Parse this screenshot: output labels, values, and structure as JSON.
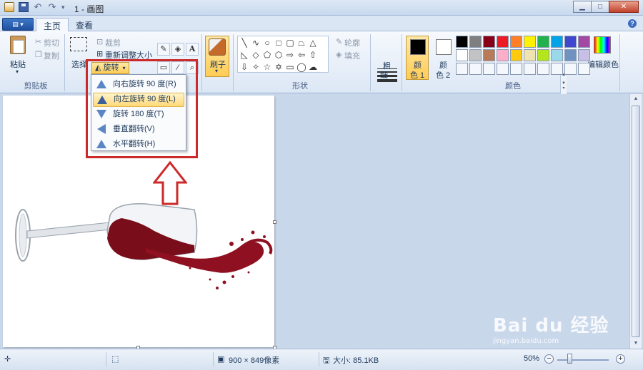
{
  "window": {
    "title": "1 - 画图"
  },
  "tabs": [
    {
      "label": "主页"
    },
    {
      "label": "查看"
    }
  ],
  "clipboard": {
    "paste": "粘贴",
    "cut": "剪切",
    "copy": "复制",
    "group": "剪贴板"
  },
  "image": {
    "select": "选择",
    "crop": "裁剪",
    "resize": "重新调整大小",
    "rotate": "旋转"
  },
  "rotate_menu": {
    "items": [
      {
        "label": "向右旋转 90 度(R)"
      },
      {
        "label": "向左旋转 90 度(L)"
      },
      {
        "label": "旋转 180 度(T)"
      },
      {
        "label": "垂直翻转(V)"
      },
      {
        "label": "水平翻转(H)"
      }
    ],
    "highlighted_index": 1
  },
  "brushes": {
    "label": "刷子"
  },
  "shapes": {
    "outline": "轮廓",
    "fill": "填充",
    "group": "形状"
  },
  "size": {
    "label_line1": "粗",
    "label_line2": "细"
  },
  "colors": {
    "color1_line1": "颜",
    "color1_line2": "色 1",
    "color2_line1": "颜",
    "color2_line2": "色 2",
    "edit": "编辑颜色",
    "group": "颜色",
    "color1": "#000000",
    "color2": "#ffffff",
    "palette": [
      "#000000",
      "#7f7f7f",
      "#880015",
      "#ed1c24",
      "#ff7f27",
      "#fff200",
      "#22b14c",
      "#00a2e8",
      "#3f48cc",
      "#a349a4",
      "#ffffff",
      "#c3c3c3",
      "#b97a57",
      "#ffaec9",
      "#ffc90e",
      "#efe4b0",
      "#b5e61d",
      "#99d9ea",
      "#7092be",
      "#c8bfe7",
      "#f4f7fc",
      "#f4f7fc",
      "#f4f7fc",
      "#f4f7fc",
      "#f4f7fc",
      "#f4f7fc",
      "#f4f7fc",
      "#f4f7fc",
      "#f4f7fc",
      "#f4f7fc"
    ]
  },
  "status": {
    "dimensions": "900 × 849像素",
    "size": "大小: 85.1KB",
    "zoom": "50%"
  },
  "watermark": {
    "brand": "Bai du 经验",
    "url": "jingyan.baidu.com"
  }
}
